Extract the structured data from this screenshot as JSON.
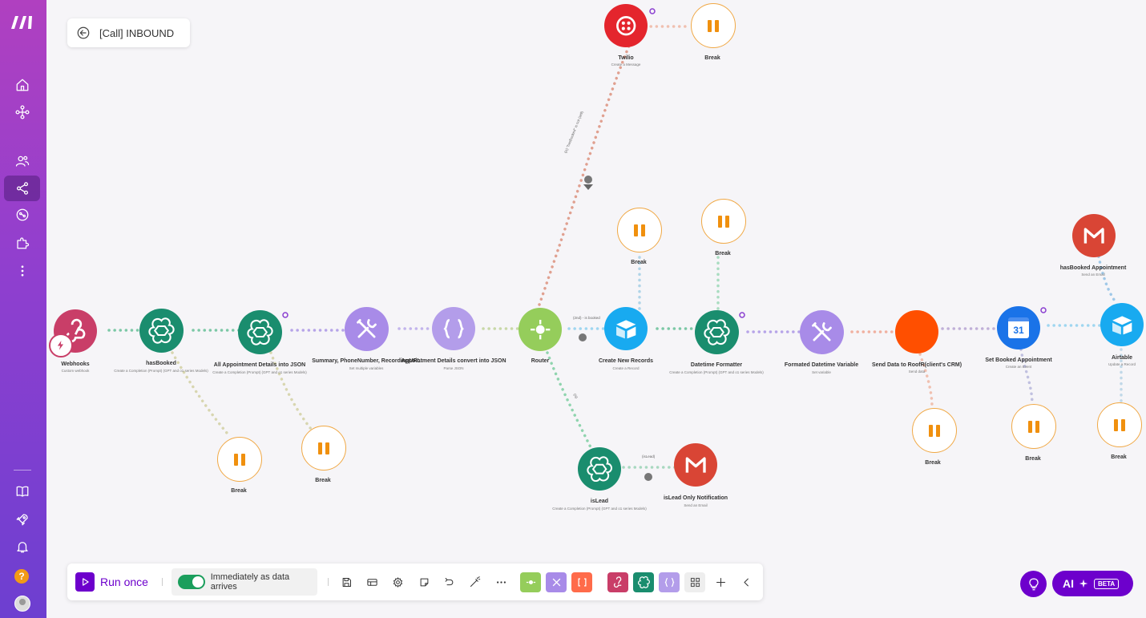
{
  "scenario": {
    "title": "[Call] INBOUND"
  },
  "modules": {
    "webhooks": {
      "label": "Webhooks",
      "sub": "Custom webhook"
    },
    "hasbooked": {
      "label": "hasBooked",
      "sub": "Create a Completion (Prompt) (GPT and o1 series Models)"
    },
    "all_appt": {
      "label": "All Appointment Details into JSON",
      "sub": "Create a Completion (Prompt) (GPT and o1 series Models)"
    },
    "summary": {
      "label": "Summary, PhoneNumber, RecordingURL",
      "sub": "Set multiple variables"
    },
    "appt_json": {
      "label": "Appointment Details convert into JSON",
      "sub": "Parse JSON"
    },
    "router": {
      "label": "Router"
    },
    "twilio": {
      "label": "Twilio",
      "sub": "Create a Message"
    },
    "create_records": {
      "label": "Create New Records",
      "sub": "Create a Record"
    },
    "datetime_fmt": {
      "label": "Datetime Formatter",
      "sub": "Create a Completion (Prompt) (GPT and o1 series Models)"
    },
    "fmt_var": {
      "label": "Formated Datetime Variable",
      "sub": "Set variable"
    },
    "roofr": {
      "label": "Send Data to RoofR(client's CRM)",
      "sub": "Send data"
    },
    "set_booked": {
      "label": "Set Booked Appointment",
      "sub": "Create an Event"
    },
    "airtable": {
      "label": "Airtable",
      "sub": "Update a Record"
    },
    "hasbooked_appt": {
      "label": "hasBooked Appointment",
      "sub": "Send an Email"
    },
    "islead": {
      "label": "isLead",
      "sub": "Create a Completion (Prompt) (GPT and o1 series Models)"
    },
    "islead_notif": {
      "label": "isLead Only Notification",
      "sub": "Send an Email"
    },
    "break_label": "Break",
    "calendar_day": "31"
  },
  "filters": {
    "router_twilio": "(is) \"hasBooked\" is not (sell)",
    "router_create": "(2nd) - is booked",
    "router_islead": "(is)",
    "islead_notif": "(isLead)"
  },
  "toolbar": {
    "run_once": "Run once",
    "schedule": "Immediately as data arrives"
  },
  "ai": {
    "label": "AI",
    "beta": "BETA"
  },
  "help": "?",
  "colors": {
    "accent": "#6d00cc",
    "openai": "#1a8d6e",
    "tools": "#a88be8",
    "json": "#b39dea",
    "router": "#95cd5b",
    "twilio": "#e4252d",
    "airtable": "#18aaf0",
    "gmail": "#d94535",
    "roofr": "#ff4f00",
    "gcal": "#1a73e8",
    "webhooks": "#c93e68",
    "break": "#f0900e"
  }
}
